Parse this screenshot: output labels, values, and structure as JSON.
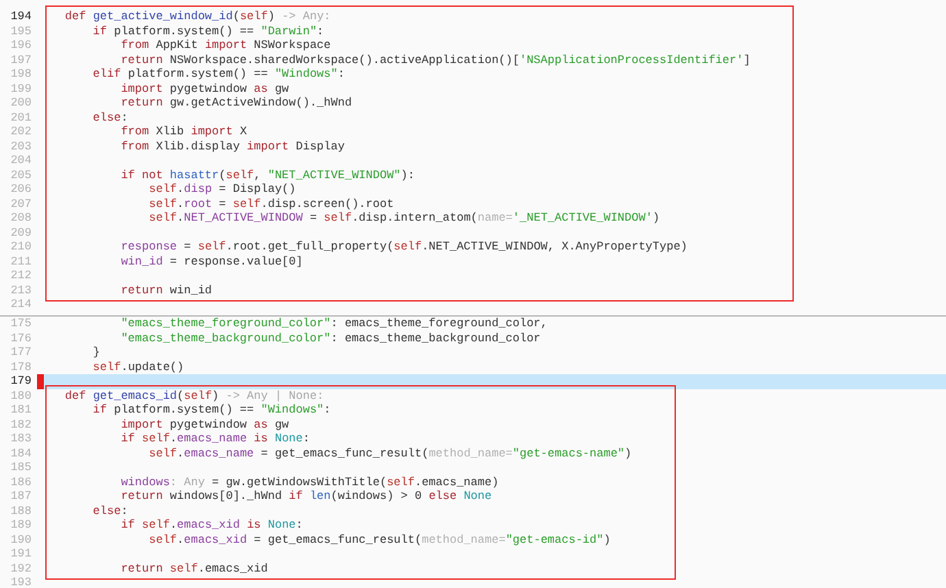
{
  "panes": [
    {
      "focused": false,
      "blocks": [
        {
          "boxed": true,
          "lines": [
            {
              "number": "194",
              "current": true,
              "marked": false,
              "tokens": [
                {
                  "text": "    def",
                  "kind": "kw"
                },
                {
                  "text": " get_active_window_id",
                  "kind": "fn"
                },
                {
                  "text": "(",
                  "kind": "plain"
                },
                {
                  "text": "self",
                  "kind": "self"
                },
                {
                  "text": ")",
                  "kind": "plain"
                },
                {
                  "text": " -> Any:",
                  "kind": "hint"
                }
              ]
            },
            {
              "number": "195",
              "current": false,
              "marked": false,
              "tokens": [
                {
                  "text": "        if",
                  "kind": "kw"
                },
                {
                  "text": " platform.system() == ",
                  "kind": "plain"
                },
                {
                  "text": "\"Darwin\"",
                  "kind": "str"
                },
                {
                  "text": ":",
                  "kind": "plain"
                }
              ]
            },
            {
              "number": "196",
              "current": false,
              "marked": false,
              "tokens": [
                {
                  "text": "            from",
                  "kind": "kw"
                },
                {
                  "text": " AppKit ",
                  "kind": "plain"
                },
                {
                  "text": "import",
                  "kind": "kw"
                },
                {
                  "text": " NSWorkspace",
                  "kind": "plain"
                }
              ]
            },
            {
              "number": "197",
              "current": false,
              "marked": false,
              "tokens": [
                {
                  "text": "            return",
                  "kind": "kw"
                },
                {
                  "text": " NSWorkspace.sharedWorkspace().activeApplication()[",
                  "kind": "plain"
                },
                {
                  "text": "'NSApplicationProcessIdentifier'",
                  "kind": "str"
                },
                {
                  "text": "]",
                  "kind": "plain"
                }
              ]
            },
            {
              "number": "198",
              "current": false,
              "marked": false,
              "tokens": [
                {
                  "text": "        elif",
                  "kind": "kw"
                },
                {
                  "text": " platform.system() == ",
                  "kind": "plain"
                },
                {
                  "text": "\"Windows\"",
                  "kind": "str"
                },
                {
                  "text": ":",
                  "kind": "plain"
                }
              ]
            },
            {
              "number": "199",
              "current": false,
              "marked": false,
              "tokens": [
                {
                  "text": "            import",
                  "kind": "kw"
                },
                {
                  "text": " pygetwindow ",
                  "kind": "plain"
                },
                {
                  "text": "as",
                  "kind": "kw"
                },
                {
                  "text": " gw",
                  "kind": "plain"
                }
              ]
            },
            {
              "number": "200",
              "current": false,
              "marked": false,
              "tokens": [
                {
                  "text": "            return",
                  "kind": "kw"
                },
                {
                  "text": " gw.getActiveWindow()._hWnd",
                  "kind": "plain"
                }
              ]
            },
            {
              "number": "201",
              "current": false,
              "marked": false,
              "tokens": [
                {
                  "text": "        else",
                  "kind": "kw"
                },
                {
                  "text": ":",
                  "kind": "plain"
                }
              ]
            },
            {
              "number": "202",
              "current": false,
              "marked": false,
              "tokens": [
                {
                  "text": "            from",
                  "kind": "kw"
                },
                {
                  "text": " Xlib ",
                  "kind": "plain"
                },
                {
                  "text": "import",
                  "kind": "kw"
                },
                {
                  "text": " X",
                  "kind": "plain"
                }
              ]
            },
            {
              "number": "203",
              "current": false,
              "marked": false,
              "tokens": [
                {
                  "text": "            from",
                  "kind": "kw"
                },
                {
                  "text": " Xlib.display ",
                  "kind": "plain"
                },
                {
                  "text": "import",
                  "kind": "kw"
                },
                {
                  "text": " Display",
                  "kind": "plain"
                }
              ]
            },
            {
              "number": "204",
              "current": false,
              "marked": false
            },
            {
              "number": "205",
              "current": false,
              "marked": false,
              "tokens": [
                {
                  "text": "            if not",
                  "kind": "kw"
                },
                {
                  "text": " hasattr",
                  "kind": "builtin"
                },
                {
                  "text": "(",
                  "kind": "plain"
                },
                {
                  "text": "self",
                  "kind": "self"
                },
                {
                  "text": ", ",
                  "kind": "plain"
                },
                {
                  "text": "\"NET_ACTIVE_WINDOW\"",
                  "kind": "str"
                },
                {
                  "text": "):",
                  "kind": "plain"
                }
              ]
            },
            {
              "number": "206",
              "current": false,
              "marked": false,
              "tokens": [
                {
                  "text": "                self",
                  "kind": "self"
                },
                {
                  "text": ".",
                  "kind": "plain"
                },
                {
                  "text": "disp",
                  "kind": "attr"
                },
                {
                  "text": " = Display()",
                  "kind": "plain"
                }
              ]
            },
            {
              "number": "207",
              "current": false,
              "marked": false,
              "tokens": [
                {
                  "text": "                self",
                  "kind": "self"
                },
                {
                  "text": ".",
                  "kind": "plain"
                },
                {
                  "text": "root",
                  "kind": "attr"
                },
                {
                  "text": " = ",
                  "kind": "plain"
                },
                {
                  "text": "self",
                  "kind": "self"
                },
                {
                  "text": ".disp.screen().root",
                  "kind": "plain"
                }
              ]
            },
            {
              "number": "208",
              "current": false,
              "marked": false,
              "tokens": [
                {
                  "text": "                self",
                  "kind": "self"
                },
                {
                  "text": ".",
                  "kind": "plain"
                },
                {
                  "text": "NET_ACTIVE_WINDOW",
                  "kind": "attr"
                },
                {
                  "text": " = ",
                  "kind": "plain"
                },
                {
                  "text": "self",
                  "kind": "self"
                },
                {
                  "text": ".disp.intern_atom(",
                  "kind": "plain"
                },
                {
                  "text": "name=",
                  "kind": "param"
                },
                {
                  "text": "'_NET_ACTIVE_WINDOW'",
                  "kind": "str"
                },
                {
                  "text": ")",
                  "kind": "plain"
                }
              ]
            },
            {
              "number": "209",
              "current": false,
              "marked": false
            },
            {
              "number": "210",
              "current": false,
              "marked": false,
              "tokens": [
                {
                  "text": "            response",
                  "kind": "attr"
                },
                {
                  "text": " = ",
                  "kind": "plain"
                },
                {
                  "text": "self",
                  "kind": "self"
                },
                {
                  "text": ".root.get_full_property(",
                  "kind": "plain"
                },
                {
                  "text": "self",
                  "kind": "self"
                },
                {
                  "text": ".NET_ACTIVE_WINDOW, X.AnyPropertyType)",
                  "kind": "plain"
                }
              ]
            },
            {
              "number": "211",
              "current": false,
              "marked": false,
              "tokens": [
                {
                  "text": "            win_id",
                  "kind": "attr"
                },
                {
                  "text": " = response.value[0]",
                  "kind": "plain"
                }
              ]
            },
            {
              "number": "212",
              "current": false,
              "marked": false
            },
            {
              "number": "213",
              "current": false,
              "marked": false,
              "tokens": [
                {
                  "text": "            return",
                  "kind": "kw"
                },
                {
                  "text": " win_id",
                  "kind": "plain"
                }
              ]
            }
          ]
        },
        {
          "boxed": false,
          "lines": [
            {
              "number": "214",
              "current": false,
              "marked": false
            }
          ]
        }
      ]
    },
    {
      "focused": true,
      "blocks": [
        {
          "boxed": false,
          "lines": [
            {
              "number": "175",
              "current": false,
              "marked": false,
              "tokens": [
                {
                  "text": "            \"emacs_theme_foreground_color\"",
                  "kind": "str"
                },
                {
                  "text": ": emacs_theme_foreground_color,",
                  "kind": "plain"
                }
              ]
            },
            {
              "number": "176",
              "current": false,
              "marked": false,
              "tokens": [
                {
                  "text": "            \"emacs_theme_background_color\"",
                  "kind": "str"
                },
                {
                  "text": ": emacs_theme_background_color",
                  "kind": "plain"
                }
              ]
            },
            {
              "number": "177",
              "current": false,
              "marked": false,
              "tokens": [
                {
                  "text": "        }",
                  "kind": "plain"
                }
              ]
            },
            {
              "number": "178",
              "current": false,
              "marked": false,
              "tokens": [
                {
                  "text": "        self",
                  "kind": "self"
                },
                {
                  "text": ".update()",
                  "kind": "plain"
                }
              ]
            },
            {
              "number": "179",
              "current": true,
              "marked": true
            }
          ]
        },
        {
          "boxed": true,
          "lines": [
            {
              "number": "180",
              "current": false,
              "marked": false,
              "tokens": [
                {
                  "text": "    def",
                  "kind": "kw"
                },
                {
                  "text": " get_emacs_id",
                  "kind": "fn"
                },
                {
                  "text": "(",
                  "kind": "plain"
                },
                {
                  "text": "self",
                  "kind": "self"
                },
                {
                  "text": ")",
                  "kind": "plain"
                },
                {
                  "text": " -> Any | None:",
                  "kind": "hint"
                }
              ]
            },
            {
              "number": "181",
              "current": false,
              "marked": false,
              "tokens": [
                {
                  "text": "        if",
                  "kind": "kw"
                },
                {
                  "text": " platform.system() == ",
                  "kind": "plain"
                },
                {
                  "text": "\"Windows\"",
                  "kind": "str"
                },
                {
                  "text": ":",
                  "kind": "plain"
                }
              ]
            },
            {
              "number": "182",
              "current": false,
              "marked": false,
              "tokens": [
                {
                  "text": "            import",
                  "kind": "kw"
                },
                {
                  "text": " pygetwindow ",
                  "kind": "plain"
                },
                {
                  "text": "as",
                  "kind": "kw"
                },
                {
                  "text": " gw",
                  "kind": "plain"
                }
              ]
            },
            {
              "number": "183",
              "current": false,
              "marked": false,
              "tokens": [
                {
                  "text": "            if",
                  "kind": "kw"
                },
                {
                  "text": " self",
                  "kind": "self"
                },
                {
                  "text": ".",
                  "kind": "plain"
                },
                {
                  "text": "emacs_name",
                  "kind": "attr"
                },
                {
                  "text": " is",
                  "kind": "kw"
                },
                {
                  "text": " None",
                  "kind": "const"
                },
                {
                  "text": ":",
                  "kind": "plain"
                }
              ]
            },
            {
              "number": "184",
              "current": false,
              "marked": false,
              "tokens": [
                {
                  "text": "                self",
                  "kind": "self"
                },
                {
                  "text": ".",
                  "kind": "plain"
                },
                {
                  "text": "emacs_name",
                  "kind": "attr"
                },
                {
                  "text": " = get_emacs_func_result(",
                  "kind": "plain"
                },
                {
                  "text": "method_name=",
                  "kind": "param"
                },
                {
                  "text": "\"get-emacs-name\"",
                  "kind": "str"
                },
                {
                  "text": ")",
                  "kind": "plain"
                }
              ]
            },
            {
              "number": "185",
              "current": false,
              "marked": false
            },
            {
              "number": "186",
              "current": false,
              "marked": false,
              "tokens": [
                {
                  "text": "            windows",
                  "kind": "attr"
                },
                {
                  "text": ": Any",
                  "kind": "hint"
                },
                {
                  "text": " = gw.getWindowsWithTitle(",
                  "kind": "plain"
                },
                {
                  "text": "self",
                  "kind": "self"
                },
                {
                  "text": ".emacs_name)",
                  "kind": "plain"
                }
              ]
            },
            {
              "number": "187",
              "current": false,
              "marked": false,
              "tokens": [
                {
                  "text": "            return",
                  "kind": "kw"
                },
                {
                  "text": " windows[0]._hWnd ",
                  "kind": "plain"
                },
                {
                  "text": "if",
                  "kind": "kw"
                },
                {
                  "text": " len",
                  "kind": "builtin"
                },
                {
                  "text": "(windows) > 0 ",
                  "kind": "plain"
                },
                {
                  "text": "else",
                  "kind": "kw"
                },
                {
                  "text": " None",
                  "kind": "const"
                }
              ]
            },
            {
              "number": "188",
              "current": false,
              "marked": false,
              "tokens": [
                {
                  "text": "        else",
                  "kind": "kw"
                },
                {
                  "text": ":",
                  "kind": "plain"
                }
              ]
            },
            {
              "number": "189",
              "current": false,
              "marked": false,
              "tokens": [
                {
                  "text": "            if",
                  "kind": "kw"
                },
                {
                  "text": " self",
                  "kind": "self"
                },
                {
                  "text": ".",
                  "kind": "plain"
                },
                {
                  "text": "emacs_xid",
                  "kind": "attr"
                },
                {
                  "text": " is",
                  "kind": "kw"
                },
                {
                  "text": " None",
                  "kind": "const"
                },
                {
                  "text": ":",
                  "kind": "plain"
                }
              ]
            },
            {
              "number": "190",
              "current": false,
              "marked": false,
              "tokens": [
                {
                  "text": "                self",
                  "kind": "self"
                },
                {
                  "text": ".",
                  "kind": "plain"
                },
                {
                  "text": "emacs_xid",
                  "kind": "attr"
                },
                {
                  "text": " = get_emacs_func_result(",
                  "kind": "plain"
                },
                {
                  "text": "method_name=",
                  "kind": "param"
                },
                {
                  "text": "\"get-emacs-id\"",
                  "kind": "str"
                },
                {
                  "text": ")",
                  "kind": "plain"
                }
              ]
            },
            {
              "number": "191",
              "current": false,
              "marked": false
            },
            {
              "number": "192",
              "current": false,
              "marked": false,
              "tokens": [
                {
                  "text": "            return",
                  "kind": "kw"
                },
                {
                  "text": " self",
                  "kind": "self"
                },
                {
                  "text": ".emacs_xid",
                  "kind": "plain"
                }
              ]
            }
          ]
        },
        {
          "boxed": false,
          "lines": [
            {
              "number": "193",
              "current": false,
              "marked": false
            }
          ]
        }
      ]
    }
  ]
}
